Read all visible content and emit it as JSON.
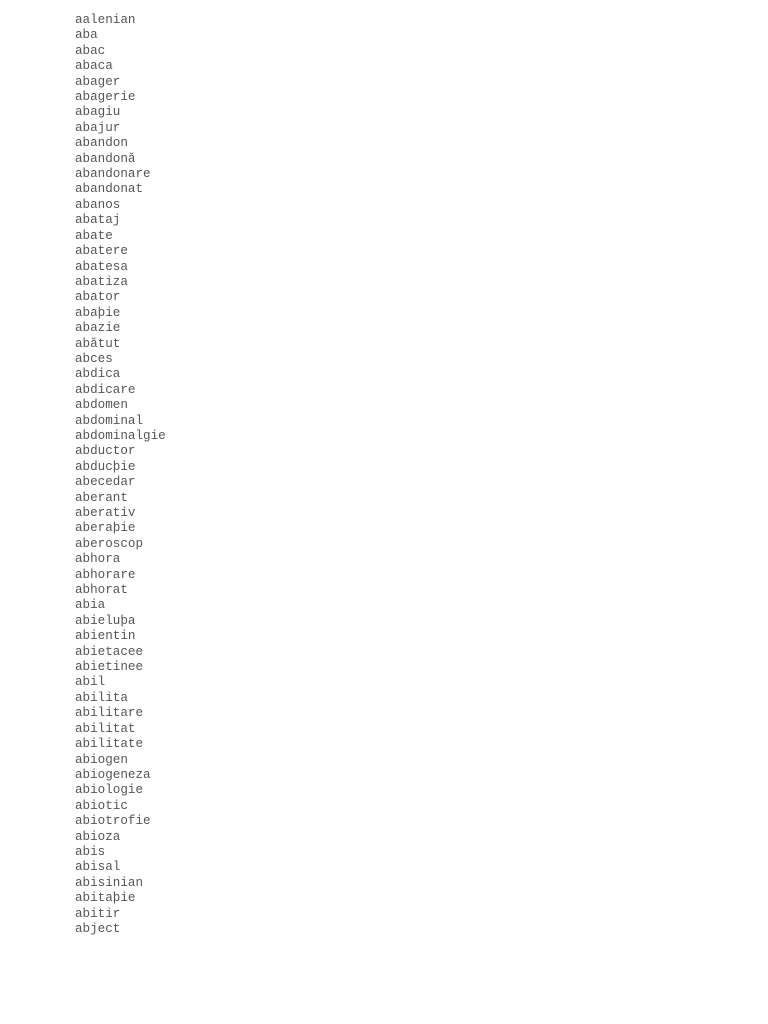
{
  "document": {
    "words": [
      "aalenian",
      "aba",
      "abac",
      "abaca",
      "abager",
      "abagerie",
      "abagiu",
      "abajur",
      "abandon",
      "abandonă",
      "abandonare",
      "abandonat",
      "abanos",
      "abataj",
      "abate",
      "abatere",
      "abatesa",
      "abatiza",
      "abator",
      "abaþie",
      "abazie",
      "abătut",
      "abces",
      "abdica",
      "abdicare",
      "abdomen",
      "abdominal",
      "abdominalgie",
      "abductor",
      "abducþie",
      "abecedar",
      "aberant",
      "aberativ",
      "aberaþie",
      "aberoscop",
      "abhora",
      "abhorare",
      "abhorat",
      "abia",
      "abieluþa",
      "abientin",
      "abietacee",
      "abietinee",
      "abil",
      "abilita",
      "abilitare",
      "abilitat",
      "abilitate",
      "abiogen",
      "abiogeneza",
      "abiologie",
      "abiotic",
      "abiotrofie",
      "abioza",
      "abis",
      "abisal",
      "abisinian",
      "abitaþie",
      "abitir",
      "abject"
    ]
  }
}
